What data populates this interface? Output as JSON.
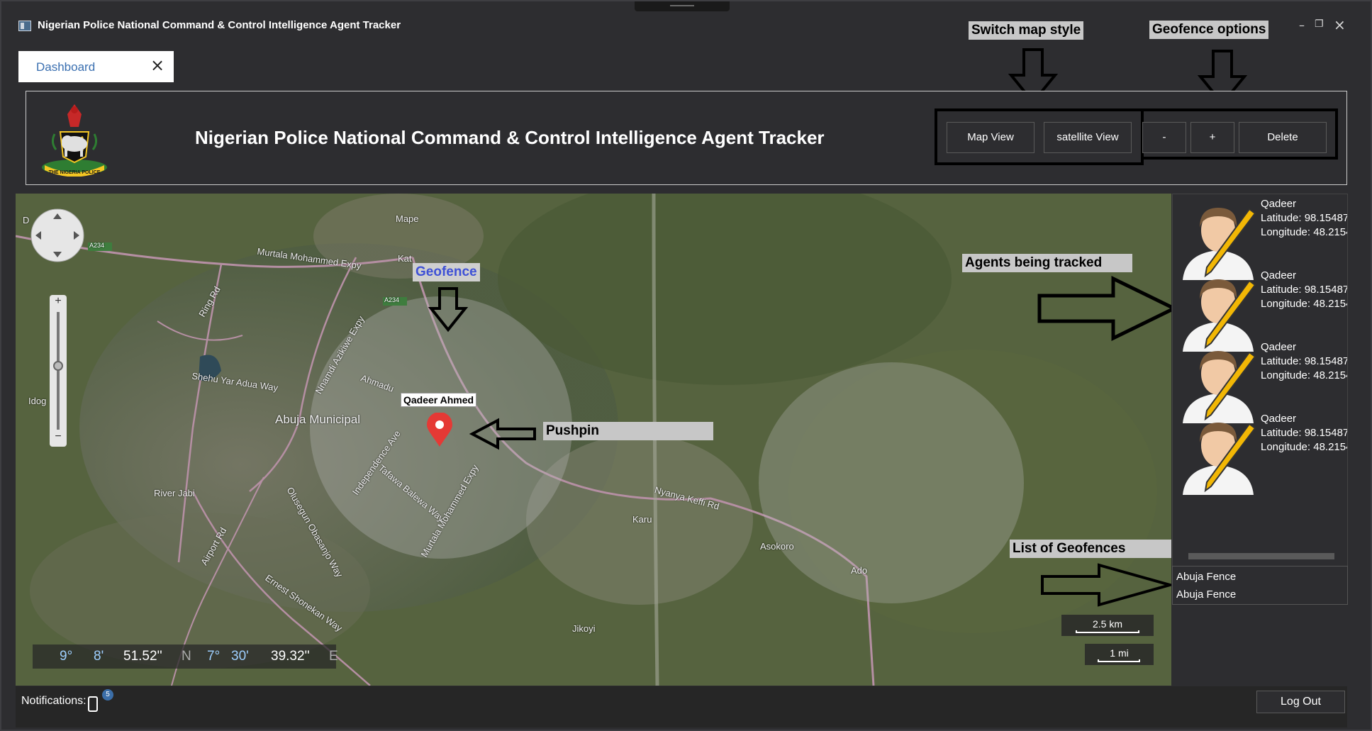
{
  "window": {
    "title": "Nigerian Police National Command & Control Intelligence Agent Tracker",
    "minimize": "–",
    "restore": "❐",
    "close": "×"
  },
  "tab": {
    "label": "Dashboard",
    "close": "×"
  },
  "header": {
    "title": "Nigerian Police National Command & Control Intelligence Agent Tracker",
    "logo_text": "THE NIGERIA POLICE",
    "map_view": "Map View",
    "satellite_view": "satellite View",
    "minus": "-",
    "plus": "+",
    "delete": "Delete"
  },
  "callouts": {
    "switch_map": "Switch map style",
    "geofence_options": "Geofence options",
    "geofence": "Geofence",
    "pushpin": "Pushpin",
    "agents": "Agents being tracked",
    "geofence_list": "List of Geofences"
  },
  "map": {
    "pin_label": "Qadeer Ahmed",
    "labels": {
      "mape": "Mape",
      "kat": "Kat",
      "a234_1": "A234",
      "a234_2": "A234",
      "murtala": "Murtala Mohammed Expy",
      "ring": "Ring Rd",
      "shehu": "Shehu Yar Adua Way",
      "nnamdi": "Nnamdi Azikiwe Expy",
      "ahmadu": "Ahmadu",
      "idog": "Idog",
      "abuja": "Abuja Municipal",
      "independence": "Independence Ave",
      "tafawa": "Tafawa Balewa Way",
      "murtala2": "Murtala Mohammed Expy",
      "river": "River Jabi",
      "olusegun": "Olusegun Obasanjo Way",
      "airport": "Airport Rd",
      "ernest": "Ernest Shonekan Way",
      "karu": "Karu",
      "nyanya": "Nyanya Keffi Rd",
      "asokoro": "Asokoro",
      "ado": "Ado",
      "jikoyi": "Jikoyi",
      "d": "D"
    },
    "zoom_plus": "+",
    "zoom_minus": "−",
    "coords": {
      "lat_deg": "9°",
      "lat_min": "8'",
      "lat_sec": "51.52''",
      "lat_dir": "N",
      "lon_deg": "7°",
      "lon_min": "30'",
      "lon_sec": "39.32''",
      "lon_dir": "E"
    },
    "scale_km": "2.5 km",
    "scale_mi": "1 mi"
  },
  "agents": [
    {
      "name": "Qadeer",
      "lat": "Latitude: 98.15487",
      "lon": "Longitude: 48.2154"
    },
    {
      "name": "Qadeer",
      "lat": "Latitude: 98.15487",
      "lon": "Longitude: 48.2154"
    },
    {
      "name": "Qadeer",
      "lat": "Latitude: 98.15487",
      "lon": "Longitude: 48.2154"
    },
    {
      "name": "Qadeer",
      "lat": "Latitude: 98.15487",
      "lon": "Longitude: 48.2154"
    }
  ],
  "geofences": [
    "Abuja Fence",
    "Abuja Fence"
  ],
  "status": {
    "notifications": "Notifications:",
    "count": "5",
    "logout": "Log Out"
  }
}
